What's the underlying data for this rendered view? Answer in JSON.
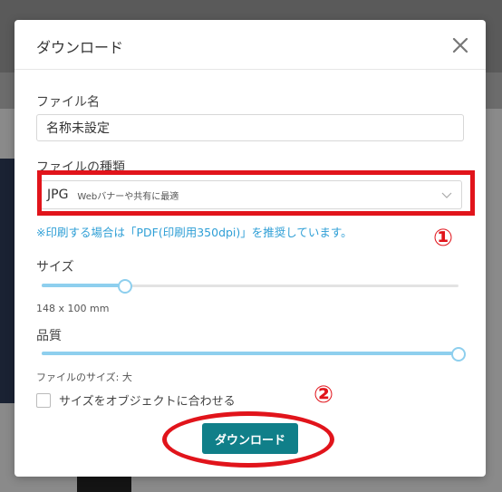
{
  "dialog": {
    "title": "ダウンロード",
    "close_icon": "close-icon"
  },
  "file_name": {
    "label": "ファイル名",
    "value": "名称未設定"
  },
  "file_type": {
    "label": "ファイルの種類",
    "selected_value": "JPG",
    "selected_description": "Webバナーや共有に最適",
    "chevron_icon": "chevron-down-icon"
  },
  "notice": "※印刷する場合は「PDF(印刷用350dpi)」を推奨しています。",
  "annotations": {
    "marker_1": "①",
    "marker_2": "②",
    "highlight_color": "#e1141b"
  },
  "size": {
    "label": "サイズ",
    "value_text": "148 x 100 mm",
    "slider_fraction": 0.2
  },
  "quality": {
    "label": "品質",
    "file_size_text": "ファイルのサイズ: 大",
    "slider_fraction": 1.0
  },
  "fit_to_object": {
    "label": "サイズをオブジェクトに合わせる",
    "checked": false
  },
  "download_button": {
    "label": "ダウンロード",
    "color": "#107f89"
  },
  "colors": {
    "accent_link": "#2f9fd6",
    "slider": "#8ecfee"
  }
}
